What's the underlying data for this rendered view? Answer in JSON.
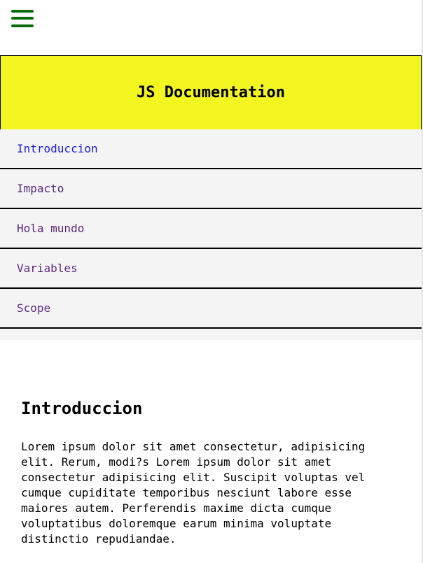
{
  "topbar": {
    "menu_icon": "hamburger-menu-icon",
    "menu_color": "#0b6b0b"
  },
  "header": {
    "title": "JS Documentation",
    "background": "#f3f520"
  },
  "nav": {
    "items": [
      {
        "label": "Introduccion",
        "active": true
      },
      {
        "label": "Impacto",
        "active": false
      },
      {
        "label": "Hola mundo",
        "active": false
      },
      {
        "label": "Variables",
        "active": false
      },
      {
        "label": "Scope",
        "active": false
      }
    ]
  },
  "main": {
    "section_title": "Introduccion",
    "paragraph": "Lorem ipsum dolor sit amet consectetur, adipisicing elit. Rerum, modi?s Lorem ipsum dolor sit amet consectetur adipisicing elit. Suscipit voluptas vel cumque cupiditate temporibus nesciunt labore esse maiores autem. Perferendis maxime dicta cumque voluptatibus doloremque earum minima voluptate distinctio repudiandae."
  }
}
